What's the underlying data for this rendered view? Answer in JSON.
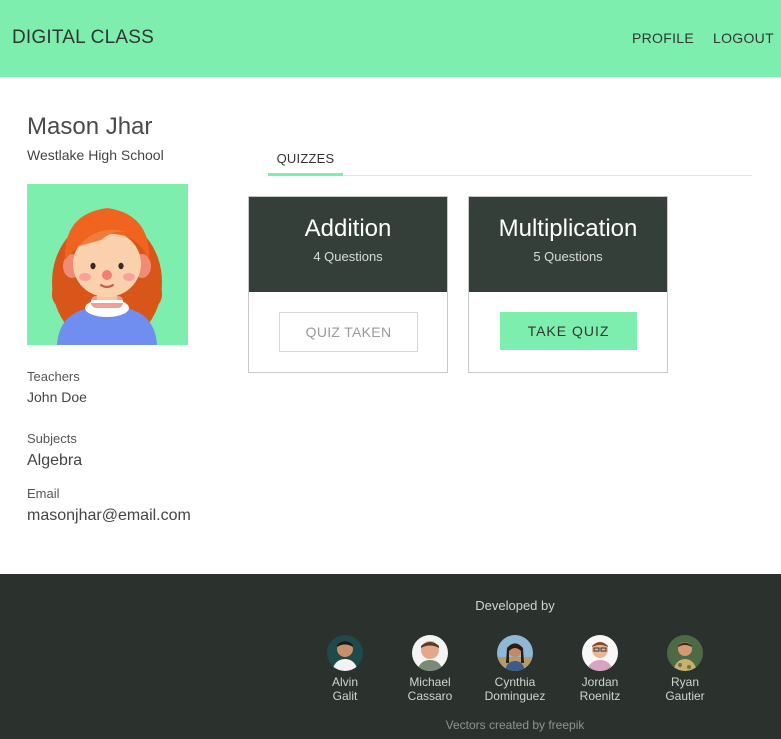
{
  "navbar": {
    "brand": "DIGITAL CLASS",
    "profile_label": "PROFILE",
    "logout_label": "LOGOUT",
    "background": "#7eeeae"
  },
  "student": {
    "name": "Mason Jhar",
    "school": "Westlake High School",
    "teachers_label": "Teachers",
    "teachers_value": "John Doe",
    "subjects_label": "Subjects",
    "subjects_value": "Algebra",
    "email_label": "Email",
    "email_value": "masonjhar@email.com"
  },
  "tabs": {
    "quizzes_label": "QUIZZES"
  },
  "quizzes": [
    {
      "title": "Addition",
      "count": "4 Questions",
      "action_label": "QUIZ TAKEN"
    },
    {
      "title": "Multiplication",
      "count": "5 Questions",
      "action_label": "TAKE QUIZ"
    }
  ],
  "footer": {
    "heading": "Developed by",
    "developers": [
      {
        "first": "Alvin",
        "last": "Galit"
      },
      {
        "first": "Michael",
        "last": "Cassaro"
      },
      {
        "first": "Cynthia",
        "last": "Dominguez"
      },
      {
        "first": "Jordan",
        "last": "Roenitz"
      },
      {
        "first": "Ryan",
        "last": "Gautier"
      }
    ],
    "credit": "Vectors created by freepik",
    "background": "#2b322e"
  },
  "colors": {
    "accent": "#7eeeae",
    "card_header": "#343f3a"
  }
}
